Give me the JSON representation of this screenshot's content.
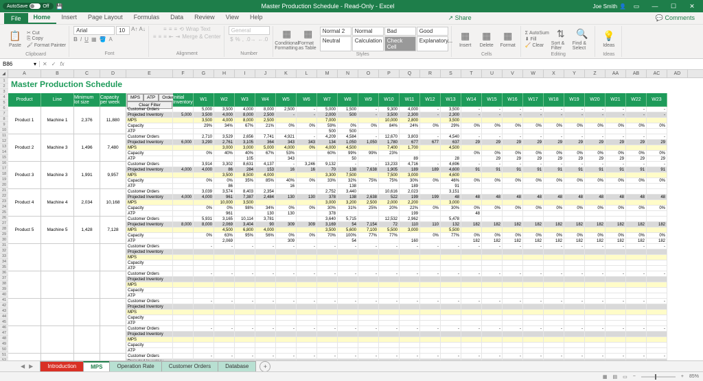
{
  "app": {
    "title": "Master Production Schedule - Read-Only - Excel",
    "user": "Joe Smith",
    "autosave_label": "AutoSave",
    "autosave_state": "Off"
  },
  "ribbon": {
    "file": "File",
    "tabs": [
      "Home",
      "Insert",
      "Page Layout",
      "Formulas",
      "Data",
      "Review",
      "View",
      "Help"
    ],
    "active": "Home",
    "share": "Share",
    "comments": "Comments",
    "groups": {
      "clipboard": {
        "label": "Clipboard",
        "paste": "Paste",
        "cut": "Cut",
        "copy": "Copy",
        "format_painter": "Format Painter"
      },
      "font": {
        "label": "Font",
        "name": "Arial",
        "size": "10"
      },
      "alignment": {
        "label": "Alignment",
        "wrap": "Wrap Text",
        "merge": "Merge & Center"
      },
      "number": {
        "label": "Number",
        "format": "General"
      },
      "styles": {
        "label": "Styles",
        "cond": "Conditional Formatting",
        "fmt_table": "Format as Table",
        "normal2": "Normal 2",
        "normal": "Normal",
        "bad": "Bad",
        "good": "Good",
        "neutral": "Neutral",
        "calc": "Calculation",
        "check": "Check Cell",
        "explan": "Explanatory..."
      },
      "cells": {
        "label": "Cells",
        "insert": "Insert",
        "delete": "Delete",
        "format": "Format"
      },
      "editing": {
        "label": "Editing",
        "autosum": "AutoSum",
        "fill": "Fill",
        "clear": "Clear",
        "sort": "Sort & Filter",
        "find": "Find & Select"
      },
      "ideas": {
        "label": "Ideas",
        "ideas": "Ideas"
      }
    }
  },
  "cellref": "B86",
  "sheet_title": "Master Production Schedule",
  "headers": {
    "product": "Product",
    "line": "Line",
    "minlot": "Minimum lot size",
    "capweek": "Capacity per week",
    "buttons": [
      "MPS",
      "ATP",
      "Orders"
    ],
    "clear": "Clear Filter",
    "initinv": "Initial Inventory"
  },
  "weeks": [
    "W1",
    "W2",
    "W3",
    "W4",
    "W5",
    "W6",
    "W7",
    "W8",
    "W9",
    "W10",
    "W11",
    "W12",
    "W13",
    "W14",
    "W15",
    "W16",
    "W17",
    "W18",
    "W19",
    "W20",
    "W21",
    "W22",
    "W23"
  ],
  "row_labels": [
    "Customer Orders",
    "Projected Inventory",
    "MPS",
    "Capacity",
    "ATP"
  ],
  "products": [
    {
      "name": "Product 1",
      "line": "Machine 1",
      "minlot": "2,376",
      "capweek": "11,880",
      "init": "5,000",
      "co": [
        "5,000",
        "3,500",
        "4,000",
        "8,000",
        "2,500",
        "-",
        "5,000",
        "1,500",
        "-",
        "9,300",
        "4,000",
        "-",
        "3,500",
        "-",
        "-",
        "-",
        "-",
        "-",
        "-",
        "-",
        "-",
        "-",
        "-"
      ],
      "pi": [
        "3,500",
        "4,000",
        "8,000",
        "2,500",
        "-",
        "-",
        "2,000",
        "500",
        "-",
        "3,500",
        "2,300",
        "-",
        "2,300",
        "-",
        "-",
        "-",
        "-",
        "-",
        "-",
        "-",
        "-",
        "-",
        "-"
      ],
      "mps": [
        "3,500",
        "4,000",
        "8,000",
        "2,500",
        "",
        "",
        "7,000",
        "",
        "",
        "10,000",
        "2,800",
        "",
        "3,500",
        "",
        "",
        "",
        "",
        "",
        "",
        "",
        "",
        "",
        ""
      ],
      "cap": [
        "29%",
        "34%",
        "67%",
        "21%",
        "0%",
        "0%",
        "59%",
        "0%",
        "0%",
        "84%",
        "24%",
        "0%",
        "29%",
        "0%",
        "0%",
        "0%",
        "0%",
        "0%",
        "0%",
        "0%",
        "0%",
        "0%",
        "0%"
      ],
      "atp": [
        "",
        "",
        "",
        "",
        "",
        "",
        "500",
        "500",
        "",
        "",
        "",
        "",
        "",
        "",
        "",
        "",
        "",
        "",
        "",
        "",
        "",
        "",
        ""
      ]
    },
    {
      "name": "Product 2",
      "line": "Machine 3",
      "minlot": "1,496",
      "capweek": "7,480",
      "init": "6,000",
      "co": [
        "2,710",
        "3,529",
        "2,656",
        "7,741",
        "4,921",
        "-",
        "4,209",
        "4,584",
        "-",
        "12,670",
        "3,803",
        "-",
        "4,540",
        "-",
        "-",
        "-",
        "-",
        "-",
        "-",
        "-",
        "-",
        "-",
        "-"
      ],
      "pi": [
        "3,290",
        "2,761",
        "3,105",
        "364",
        "343",
        "343",
        "134",
        "1,050",
        "1,050",
        "1,780",
        "677",
        "677",
        "637",
        "29",
        "29",
        "29",
        "29",
        "29",
        "29",
        "29",
        "29",
        "29",
        "29"
      ],
      "mps": [
        "",
        "3,000",
        "3,000",
        "5,000",
        "4,000",
        "0%",
        "4,000",
        "4,500",
        "",
        "7,400",
        "1,700",
        "",
        "4,500",
        "",
        "",
        "",
        "",
        "",
        "",
        "",
        "",
        "",
        ""
      ],
      "cap": [
        "0%",
        "40%",
        "40%",
        "67%",
        "53%",
        "",
        "60%",
        "99%",
        "99%",
        "23%",
        "",
        "",
        "",
        "0%",
        "0%",
        "0%",
        "0%",
        "0%",
        "0%",
        "0%",
        "0%",
        "0%",
        "0%"
      ],
      "atp": [
        "",
        "",
        "105",
        "",
        "343",
        "",
        "",
        "50",
        "",
        "",
        "89",
        "",
        "28",
        "",
        "29",
        "29",
        "29",
        "29",
        "29",
        "29",
        "29",
        "29",
        "29"
      ]
    },
    {
      "name": "Product 3",
      "line": "Machine 3",
      "minlot": "1,991",
      "capweek": "9,957",
      "init": "4,000",
      "co": [
        "3,914",
        "3,302",
        "8,631",
        "4,137",
        "-",
        "3,246",
        "9,132",
        "-",
        "-",
        "13,233",
        "4,716",
        "-",
        "4,696",
        "-",
        "-",
        "-",
        "-",
        "-",
        "-",
        "-",
        "-",
        "-",
        "-"
      ],
      "pi": [
        "4,000",
        "86",
        "284",
        "153",
        "16",
        "16",
        "70",
        "138",
        "7,638",
        "1,905",
        "189",
        "189",
        "4,600",
        "91",
        "91",
        "91",
        "91",
        "91",
        "91",
        "91",
        "91",
        "91",
        "91"
      ],
      "mps": [
        "",
        "3,500",
        "8,500",
        "4,000",
        "",
        "",
        "3,300",
        "7,500",
        "",
        "7,500",
        "3,000",
        "",
        "4,600",
        "",
        "",
        "",
        "",
        "",
        "",
        "",
        "",
        "",
        ""
      ],
      "cap": [
        "0%",
        "0%",
        "35%",
        "85%",
        "40%",
        "0%",
        "33%",
        "32%",
        "75%",
        "75%",
        "30%",
        "0%",
        "46%",
        "0%",
        "0%",
        "0%",
        "0%",
        "0%",
        "0%",
        "0%",
        "0%",
        "0%",
        "0%"
      ],
      "atp": [
        "",
        "86",
        "",
        "",
        "16",
        "",
        "",
        "138",
        "",
        "",
        "189",
        "",
        "91",
        "",
        "",
        "",
        "",
        "",
        "",
        "",
        "",
        "",
        ""
      ]
    },
    {
      "name": "Product 4",
      "line": "Machine 4",
      "minlot": "2,034",
      "capweek": "10,168",
      "init": "4,000",
      "co": [
        "3,039",
        "3,574",
        "8,403",
        "2,354",
        "",
        "",
        "2,752",
        "3,440",
        "",
        "10,616",
        "2,023",
        "",
        "3,151",
        "",
        "",
        "",
        "",
        "",
        "",
        "",
        "",
        "",
        ""
      ],
      "pi": [
        "4,000",
        "961",
        "7,387",
        "2,484",
        "130",
        "130",
        "378",
        "138",
        "2,638",
        "522",
        "199",
        "199",
        "48",
        "48",
        "48",
        "48",
        "48",
        "48",
        "48",
        "48",
        "48",
        "48",
        "48"
      ],
      "mps": [
        "",
        "10,000",
        "3,500",
        "",
        "",
        "",
        "3,000",
        "3,200",
        "2,500",
        "2,000",
        "2,200",
        "",
        "3,000",
        "",
        "",
        "",
        "",
        "",
        "",
        "",
        "",
        "",
        ""
      ],
      "cap": [
        "0%",
        "0%",
        "98%",
        "34%",
        "0%",
        "0%",
        "30%",
        "31%",
        "25%",
        "20%",
        "22%",
        "0%",
        "30%",
        "0%",
        "0%",
        "0%",
        "0%",
        "0%",
        "0%",
        "0%",
        "0%",
        "0%",
        "0%"
      ],
      "atp": [
        "",
        "961",
        "",
        "130",
        "130",
        "",
        "378",
        "",
        "",
        "",
        "199",
        "",
        "",
        "48",
        "",
        "",
        "",
        "",
        "",
        "",
        "",
        "",
        ""
      ]
    },
    {
      "name": "Product 5",
      "line": "Machine 5",
      "minlot": "1,428",
      "capweek": "7,128",
      "init": "8,000",
      "co": [
        "5,931",
        "3,165",
        "10,114",
        "3,781",
        "",
        "",
        "3,640",
        "5,715",
        "",
        "12,532",
        "2,962",
        "",
        "5,478",
        "",
        "",
        "",
        "",
        "",
        "",
        "",
        "",
        "",
        ""
      ],
      "pi": [
        "8,000",
        "2,069",
        "3,404",
        "90",
        "309",
        "309",
        "3,169",
        "54",
        "7,154",
        "72",
        "110",
        "110",
        "132",
        "182",
        "182",
        "182",
        "182",
        "182",
        "182",
        "182",
        "182",
        "182",
        "182"
      ],
      "mps": [
        "",
        "4,500",
        "6,800",
        "4,000",
        "",
        "",
        "3,500",
        "5,600",
        "7,100",
        "5,500",
        "3,000",
        "",
        "5,500",
        "",
        "",
        "",
        "",
        "",
        "",
        "",
        "",
        "",
        ""
      ],
      "cap": [
        "0%",
        "63%",
        "95%",
        "56%",
        "0%",
        "0%",
        "70%",
        "100%",
        "77%",
        "77%",
        "",
        "0%",
        "77%",
        "0%",
        "0%",
        "0%",
        "0%",
        "0%",
        "0%",
        "0%",
        "0%",
        "0%",
        "0%"
      ],
      "atp": [
        "",
        "2,069",
        "",
        "",
        "309",
        "",
        "",
        "54",
        "",
        "",
        "160",
        "",
        "",
        "182",
        "182",
        "182",
        "182",
        "182",
        "182",
        "182",
        "182",
        "182",
        "182"
      ]
    }
  ],
  "empty_blocks": 5,
  "sheet_tabs": [
    {
      "name": "Introduction",
      "cls": "red"
    },
    {
      "name": "MPS",
      "cls": "active"
    },
    {
      "name": "Operation Rate",
      "cls": "teal"
    },
    {
      "name": "Customer Orders",
      "cls": "teal"
    },
    {
      "name": "Database",
      "cls": "teal"
    }
  ],
  "status": {
    "zoom": "85%"
  },
  "columns": [
    "A",
    "B",
    "C",
    "D",
    "E",
    "F",
    "G",
    "H",
    "I",
    "J",
    "K",
    "L",
    "M",
    "N",
    "O",
    "P",
    "Q",
    "R",
    "S",
    "T",
    "U",
    "V",
    "W",
    "X",
    "Y",
    "Z",
    "AA",
    "AB",
    "AC",
    "AD"
  ]
}
